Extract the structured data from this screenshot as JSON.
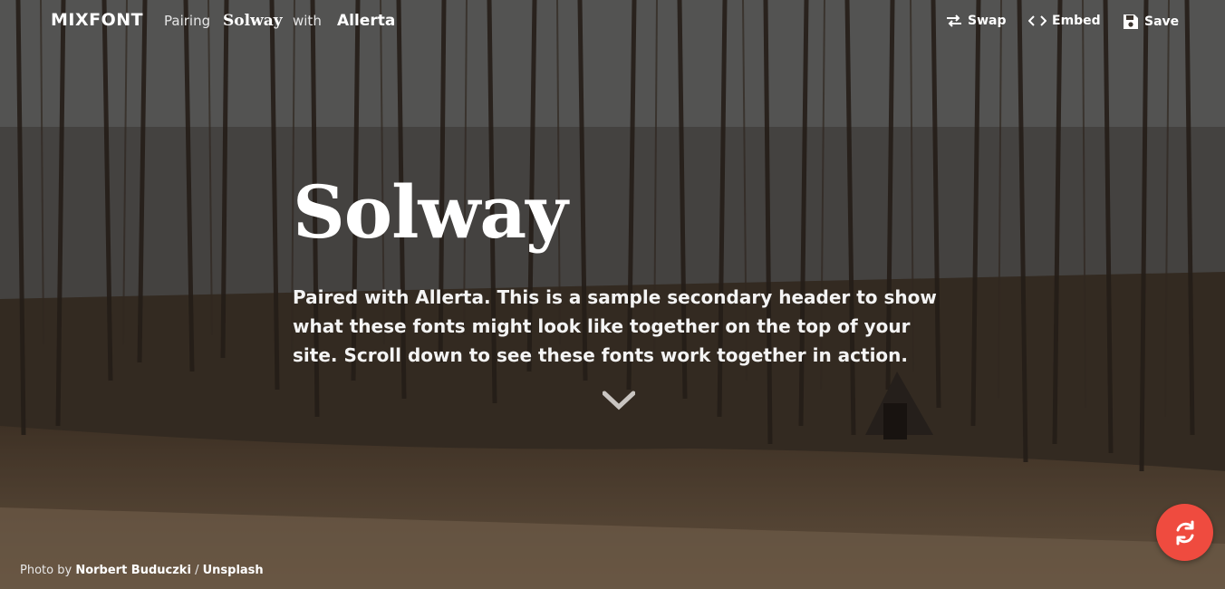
{
  "header": {
    "logo": "MIXFONT",
    "pairing_label": "Pairing",
    "primary_font": "Solway",
    "with_label": "with",
    "secondary_font": "Allerta",
    "swap_label": "Swap",
    "embed_label": "Embed",
    "save_label": "Save"
  },
  "hero": {
    "title": "Solway",
    "subtitle": "Paired with Allerta. This is a sample secondary header to show what these fonts might look like together on the top of your site. Scroll down to see these fonts work together in action."
  },
  "credit": {
    "prefix": "Photo by",
    "author": "Norbert Buduczki",
    "separator": "/",
    "source": "Unsplash"
  },
  "icons": {
    "swap": "swap-arrows-icon",
    "embed": "code-icon",
    "save": "floppy-disk-icon",
    "scroll": "chevron-down-icon",
    "refresh": "refresh-icon"
  },
  "colors": {
    "refresh_button": "#ef4b3f",
    "text": "#ffffff"
  }
}
